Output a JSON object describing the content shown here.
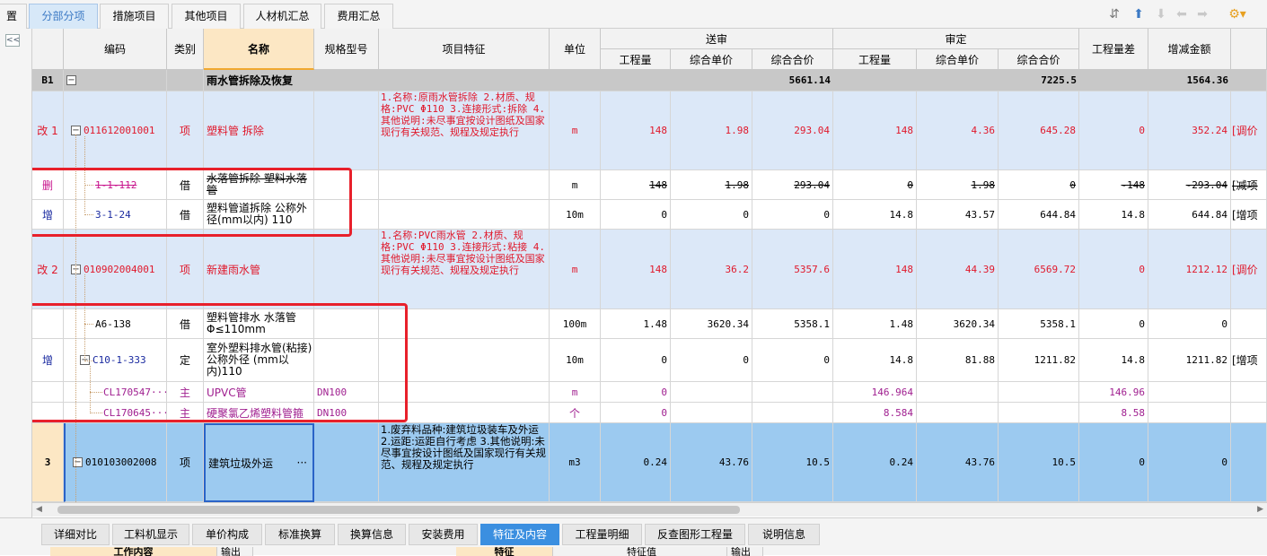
{
  "tabs": [
    {
      "label": "置",
      "active": false
    },
    {
      "label": "分部分项",
      "active": true
    },
    {
      "label": "措施项目",
      "active": false
    },
    {
      "label": "其他项目",
      "active": false
    },
    {
      "label": "人材机汇总",
      "active": false
    },
    {
      "label": "费用汇总",
      "active": false
    }
  ],
  "toolbar_icons": [
    "sort-icon",
    "arrow-up-icon",
    "arrow-down-icon",
    "arrow-left-icon",
    "arrow-right-icon",
    "settings-dropdown-icon"
  ],
  "collapse_label": "<<",
  "columns": {
    "code": "编码",
    "category": "类别",
    "name": "名称",
    "spec": "规格型号",
    "feature": "项目特征",
    "unit": "单位",
    "submit_group": "送审",
    "review_group": "审定",
    "qty": "工程量",
    "unit_price": "综合单价",
    "total": "综合合价",
    "qty_diff": "工程量差",
    "amount_diff": "增减金额"
  },
  "rows": [
    {
      "no": "B1",
      "code": "",
      "cat": "",
      "name": "雨水管拆除及恢复",
      "spec": "",
      "feature": "",
      "unit": "",
      "s_qty": "",
      "s_price": "",
      "s_total": "5661.14",
      "r_qty": "",
      "r_price": "",
      "r_total": "7225.5",
      "diff_qty": "",
      "diff_amt": "1564.36",
      "extra": ""
    },
    {
      "no": "改 1",
      "code": "011612001001",
      "cat": "项",
      "name": "塑料管 拆除",
      "spec": "",
      "feature": "1.名称:原雨水管拆除 2.材质、规格:PVC Φ110 3.连接形式:拆除 4.其他说明:未尽事宜按设计图纸及国家现行有关规范、规程及规定执行",
      "unit": "m",
      "s_qty": "148",
      "s_price": "1.98",
      "s_total": "293.04",
      "r_qty": "148",
      "r_price": "4.36",
      "r_total": "645.28",
      "diff_qty": "0",
      "diff_amt": "352.24",
      "extra": "[调价"
    },
    {
      "no": "删",
      "code": "1-1-112",
      "cat": "借",
      "name": "水落管拆除 塑料水落管",
      "spec": "",
      "feature": "",
      "unit": "m",
      "s_qty": "148",
      "s_price": "1.98",
      "s_total": "293.04",
      "r_qty": "0",
      "r_price": "1.98",
      "r_total": "0",
      "diff_qty": "-148",
      "diff_amt": "-293.04",
      "extra": "[减项"
    },
    {
      "no": "增",
      "code": "3-1-24",
      "cat": "借",
      "name": "塑料管道拆除 公称外径(mm以内) 110",
      "spec": "",
      "feature": "",
      "unit": "10m",
      "s_qty": "0",
      "s_price": "0",
      "s_total": "0",
      "r_qty": "14.8",
      "r_price": "43.57",
      "r_total": "644.84",
      "diff_qty": "14.8",
      "diff_amt": "644.84",
      "extra": "[增项"
    },
    {
      "no": "改 2",
      "code": "010902004001",
      "cat": "项",
      "name": "新建雨水管",
      "spec": "",
      "feature": "1.名称:PVC雨水管 2.材质、规格:PVC Φ110 3.连接形式:粘接 4.其他说明:未尽事宜按设计图纸及国家现行有关规范、规程及规定执行",
      "unit": "m",
      "s_qty": "148",
      "s_price": "36.2",
      "s_total": "5357.6",
      "r_qty": "148",
      "r_price": "44.39",
      "r_total": "6569.72",
      "diff_qty": "0",
      "diff_amt": "1212.12",
      "extra": "[调价"
    },
    {
      "no": "",
      "code": "A6-138",
      "cat": "借",
      "name": "塑料管排水 水落管 Φ≤110mm",
      "spec": "",
      "feature": "",
      "unit": "100m",
      "s_qty": "1.48",
      "s_price": "3620.34",
      "s_total": "5358.1",
      "r_qty": "1.48",
      "r_price": "3620.34",
      "r_total": "5358.1",
      "diff_qty": "0",
      "diff_amt": "0",
      "extra": ""
    },
    {
      "no": "增",
      "code": "C10-1-333",
      "cat": "定",
      "name": "室外塑料排水管(粘接) 公称外径 (mm以内)110",
      "spec": "",
      "feature": "",
      "unit": "10m",
      "s_qty": "0",
      "s_price": "0",
      "s_total": "0",
      "r_qty": "14.8",
      "r_price": "81.88",
      "r_total": "1211.82",
      "diff_qty": "14.8",
      "diff_amt": "1211.82",
      "extra": "[增项"
    },
    {
      "no": "",
      "code": "CL170547···",
      "cat": "主",
      "name": "UPVC管",
      "spec": "DN100",
      "feature": "",
      "unit": "m",
      "s_qty": "0",
      "s_price": "",
      "s_total": "",
      "r_qty": "146.964",
      "r_price": "",
      "r_total": "",
      "diff_qty": "146.96",
      "diff_amt": "",
      "extra": ""
    },
    {
      "no": "",
      "code": "CL170645···",
      "cat": "主",
      "name": "硬聚氯乙烯塑料管箍",
      "spec": "DN100",
      "feature": "",
      "unit": "个",
      "s_qty": "0",
      "s_price": "",
      "s_total": "",
      "r_qty": "8.584",
      "r_price": "",
      "r_total": "",
      "diff_qty": "8.58",
      "diff_amt": "",
      "extra": ""
    },
    {
      "no": "3",
      "code": "010103002008",
      "cat": "项",
      "name": "建筑垃圾外运",
      "spec": "",
      "feature": "1.废弃料品种:建筑垃圾装车及外运 2.运距:运距自行考虑 3.其他说明:未尽事宜按设计图纸及国家现行有关规范、规程及规定执行",
      "unit": "m3",
      "s_qty": "0.24",
      "s_price": "43.76",
      "s_total": "10.5",
      "r_qty": "0.24",
      "r_price": "43.76",
      "r_total": "10.5",
      "diff_qty": "0",
      "diff_amt": "0",
      "extra": "",
      "name_more": "···"
    }
  ],
  "bottom_tabs": [
    {
      "label": "详细对比",
      "active": false
    },
    {
      "label": "工料机显示",
      "active": false
    },
    {
      "label": "单价构成",
      "active": false
    },
    {
      "label": "标准换算",
      "active": false
    },
    {
      "label": "换算信息",
      "active": false
    },
    {
      "label": "安装费用",
      "active": false
    },
    {
      "label": "特征及内容",
      "active": true
    },
    {
      "label": "工程量明细",
      "active": false
    },
    {
      "label": "反查图形工程量",
      "active": false
    },
    {
      "label": "说明信息",
      "active": false
    }
  ],
  "bottom_subheaders": {
    "work": "工作内容",
    "output1": "输出",
    "feature": "特征",
    "value": "特征值",
    "output2": "输出"
  }
}
